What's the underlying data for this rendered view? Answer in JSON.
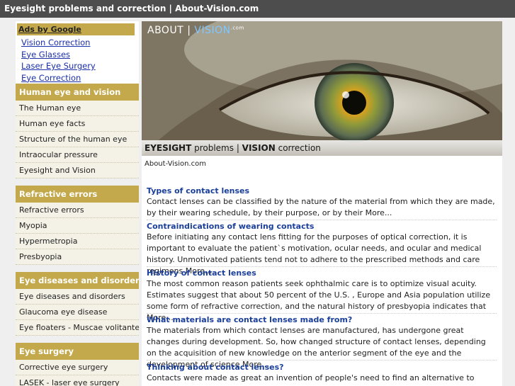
{
  "page_title": "Eyesight problems and correction | About-Vision.com",
  "ads": {
    "title": "Ads by Google",
    "links": [
      "Vision Correction",
      "Eye Glasses",
      "Laser Eye Surgery",
      "Eye Correction"
    ]
  },
  "sections": [
    {
      "title": "Human eye and vision",
      "items": [
        "The Human eye",
        "Human eye facts",
        "Structure of the human eye",
        "Intraocular pressure",
        "Eyesight and Vision"
      ]
    },
    {
      "title": "Refractive errors",
      "items": [
        "Refractive errors",
        "Myopia",
        "Hypermetropia",
        "Presbyopia"
      ]
    },
    {
      "title": "Eye diseases and disorders",
      "items": [
        "Eye diseases and disorders",
        "Glaucoma eye disease",
        "Eye floaters - Muscae volitantes"
      ]
    },
    {
      "title": "Eye surgery",
      "items": [
        "Corrective eye surgery",
        "LASEK - laser eye surgery"
      ]
    }
  ],
  "hero": {
    "logo_left": "ABOUT | ",
    "logo_right": "VISION",
    "logo_sup": ".com",
    "caption_bold1": "EYESIGHT",
    "caption_mid": " problems | ",
    "caption_bold2": "VISION",
    "caption_end": " correction"
  },
  "site_domain": "About-Vision.com",
  "articles": [
    {
      "title": "Types of contact lenses",
      "body": "Contact lenses can be classified by the nature of the material from which they are made, by their wearing schedule, by their purpose, or by their More..."
    },
    {
      "title": "Contraindications of wearing contacts",
      "body": "Before initiating any contact lens fitting for the purposes of optical correction, it is important to evaluate the patient`s motivation, ocular needs, and ocular and medical history. Unmotivated patients tend not to adhere to the prescribed methods and care regimens More..."
    },
    {
      "title": "History of contact lenses",
      "body": "The most common reason patients seek ophthalmic care is to optimize visual acuity. Estimates suggest that about 50 percent of the U.S. , Europe and Asia population utilize some form of refractive correction, and the natural history of presbyopia indicates that More..."
    },
    {
      "title": "What materials are contact lenses made from?",
      "body": "The materials from which contact lenses are manufactured, has undergone great changes during development. So, how changed structure of contact lenses, depending on the acquisition of new knowledge on the anterior segment of the eye and the development of science More..."
    },
    {
      "title": "Thinking about contact lenses?",
      "body": "Contacts were made as great an invention of people's need to find an alternative to eyeglasses and"
    }
  ]
}
